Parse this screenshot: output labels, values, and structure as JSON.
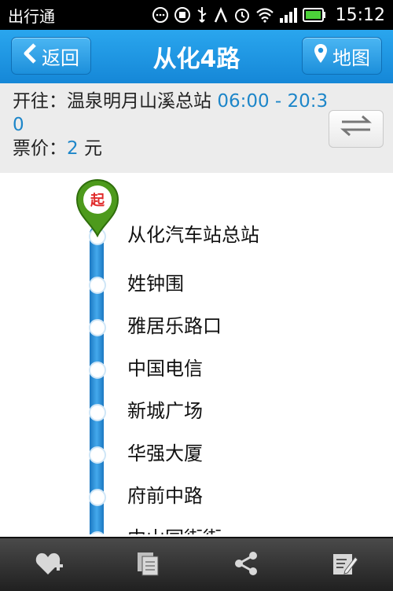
{
  "statusbar": {
    "app_name": "出行通",
    "time": "15:12"
  },
  "header": {
    "back_label": "返回",
    "title": "从化4路",
    "map_label": "地图"
  },
  "info": {
    "direction_prefix": "开往：",
    "destination": "温泉明月山溪总站",
    "hours": "06:00 - 20:30",
    "fare_prefix": "票价：",
    "fare_value": "2",
    "fare_unit": "元"
  },
  "start_marker": "起",
  "stops": [
    "从化汽车站总站",
    "姓钟围",
    "雅居乐路口",
    "中国电信",
    "新城广场",
    "华强大厦",
    "府前中路",
    "中山园街街"
  ],
  "colors": {
    "accent": "#1d86c9",
    "header": "#1a8fdc"
  },
  "bottombar": {
    "icons": [
      "favorite-add-icon",
      "copy-icon",
      "share-icon",
      "edit-icon"
    ]
  }
}
